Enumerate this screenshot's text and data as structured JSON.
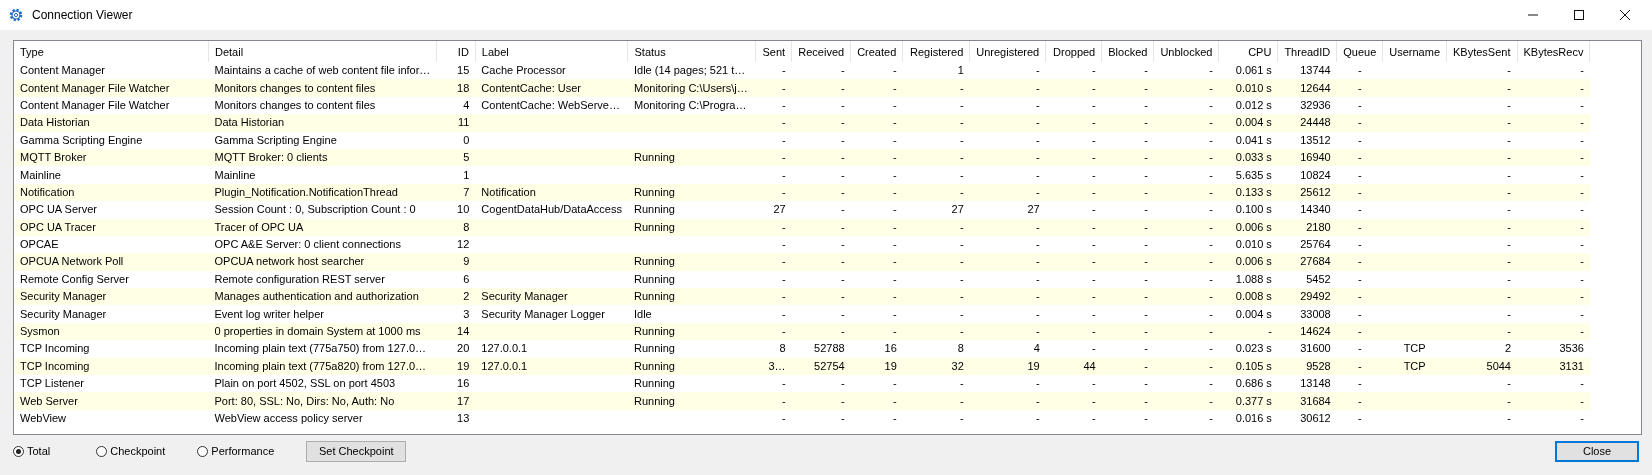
{
  "window": {
    "title": "Connection Viewer"
  },
  "table": {
    "columns": [
      {
        "label": "Type",
        "kind": "text"
      },
      {
        "label": "Detail",
        "kind": "text"
      },
      {
        "label": "ID",
        "kind": "number"
      },
      {
        "label": "Label",
        "kind": "text"
      },
      {
        "label": "Status",
        "kind": "text"
      },
      {
        "label": "Sent",
        "kind": "number"
      },
      {
        "label": "Received",
        "kind": "number"
      },
      {
        "label": "Created",
        "kind": "number"
      },
      {
        "label": "Registered",
        "kind": "number"
      },
      {
        "label": "Unregistered",
        "kind": "number"
      },
      {
        "label": "Dropped",
        "kind": "number"
      },
      {
        "label": "Blocked",
        "kind": "number"
      },
      {
        "label": "Unblocked",
        "kind": "number"
      },
      {
        "label": "CPU",
        "kind": "number"
      },
      {
        "label": "ThreadID",
        "kind": "number"
      },
      {
        "label": "Queue",
        "kind": "center"
      },
      {
        "label": "Username",
        "kind": "center"
      },
      {
        "label": "KBytesSent",
        "kind": "number"
      },
      {
        "label": "KBytesRecv",
        "kind": "number"
      }
    ],
    "rows": [
      [
        "Content Manager",
        "Maintains a cache of web content file infor…",
        "15",
        "Cache Processor",
        "Idle (14 pages; 521 t…",
        "-",
        "-",
        "-",
        "1",
        "-",
        "-",
        "-",
        "-",
        "0.061 s",
        "13744",
        "-",
        null,
        "-",
        "-"
      ],
      [
        "Content Manager File Watcher",
        "Monitors changes to content files",
        "18",
        "ContentCache: User",
        "Monitoring C:\\Users\\j…",
        "-",
        "-",
        "-",
        "-",
        "-",
        "-",
        "-",
        "-",
        "0.010 s",
        "12644",
        "-",
        null,
        "-",
        "-"
      ],
      [
        "Content Manager File Watcher",
        "Monitors changes to content files",
        "4",
        "ContentCache: WebServe…",
        "Monitoring C:\\Progra…",
        "-",
        "-",
        "-",
        "-",
        "-",
        "-",
        "-",
        "-",
        "0.012 s",
        "32936",
        "-",
        null,
        "-",
        "-"
      ],
      [
        "Data Historian",
        "Data Historian",
        "11",
        null,
        null,
        "-",
        "-",
        "-",
        "-",
        "-",
        "-",
        "-",
        "-",
        "0.004 s",
        "24448",
        "-",
        null,
        "-",
        "-"
      ],
      [
        "Gamma Scripting Engine",
        "Gamma Scripting Engine",
        "0",
        null,
        null,
        "-",
        "-",
        "-",
        "-",
        "-",
        "-",
        "-",
        "-",
        "0.041 s",
        "13512",
        "-",
        null,
        "-",
        "-"
      ],
      [
        "MQTT Broker",
        "MQTT Broker: 0 clients",
        "5",
        null,
        "Running",
        "-",
        "-",
        "-",
        "-",
        "-",
        "-",
        "-",
        "-",
        "0.033 s",
        "16940",
        "-",
        null,
        "-",
        "-"
      ],
      [
        "Mainline",
        "Mainline",
        "1",
        null,
        null,
        "-",
        "-",
        "-",
        "-",
        "-",
        "-",
        "-",
        "-",
        "5.635 s",
        "10824",
        "-",
        null,
        "-",
        "-"
      ],
      [
        "Notification",
        "Plugin_Notification.NotificationThread",
        "7",
        "Notification",
        "Running",
        "-",
        "-",
        "-",
        "-",
        "-",
        "-",
        "-",
        "-",
        "0.133 s",
        "25612",
        "-",
        null,
        "-",
        "-"
      ],
      [
        "OPC UA Server",
        "Session Count : 0, Subscription Count : 0",
        "10",
        "CogentDataHub/DataAccess",
        "Running",
        "27",
        "-",
        "-",
        "27",
        "27",
        "-",
        "-",
        "-",
        "0.100 s",
        "14340",
        "-",
        null,
        "-",
        "-"
      ],
      [
        "OPC UA Tracer",
        "Tracer of OPC UA",
        "8",
        null,
        "Running",
        "-",
        "-",
        "-",
        "-",
        "-",
        "-",
        "-",
        "-",
        "0.006 s",
        "2180",
        "-",
        null,
        "-",
        "-"
      ],
      [
        "OPCAE",
        "OPC A&E Server: 0 client connections",
        "12",
        null,
        null,
        "-",
        "-",
        "-",
        "-",
        "-",
        "-",
        "-",
        "-",
        "0.010 s",
        "25764",
        "-",
        null,
        "-",
        "-"
      ],
      [
        "OPCUA Network Poll",
        "OPCUA network host searcher",
        "9",
        null,
        "Running",
        "-",
        "-",
        "-",
        "-",
        "-",
        "-",
        "-",
        "-",
        "0.006 s",
        "27684",
        "-",
        null,
        "-",
        "-"
      ],
      [
        "Remote Config Server",
        "Remote configuration REST server",
        "6",
        null,
        "Running",
        "-",
        "-",
        "-",
        "-",
        "-",
        "-",
        "-",
        "-",
        "1.088 s",
        "5452",
        "-",
        null,
        "-",
        "-"
      ],
      [
        "Security Manager",
        "Manages authentication and authorization",
        "2",
        "Security Manager",
        "Running",
        "-",
        "-",
        "-",
        "-",
        "-",
        "-",
        "-",
        "-",
        "0.008 s",
        "29492",
        "-",
        null,
        "-",
        "-"
      ],
      [
        "Security Manager",
        "Event log writer helper",
        "3",
        "Security Manager Logger",
        "Idle",
        "-",
        "-",
        "-",
        "-",
        "-",
        "-",
        "-",
        "-",
        "0.004 s",
        "33008",
        "-",
        null,
        "-",
        "-"
      ],
      [
        "Sysmon",
        "0 properties in domain System at 1000 ms",
        "14",
        null,
        "Running",
        "-",
        "-",
        "-",
        "-",
        "-",
        "-",
        "-",
        "-",
        "-",
        "14624",
        "-",
        null,
        "-",
        "-"
      ],
      [
        "TCP Incoming",
        "Incoming plain text (775a750) from 127.0…",
        "20",
        "127.0.0.1",
        "Running",
        "8",
        "52788",
        "16",
        "8",
        "4",
        "-",
        "-",
        "-",
        "0.023 s",
        "31600",
        "-",
        "TCP",
        "2",
        "3536"
      ],
      [
        "TCP Incoming",
        "Incoming plain text (775a820) from 127.0…",
        "19",
        "127.0.0.1",
        "Running",
        "3…",
        "52754",
        "19",
        "32",
        "19",
        "44",
        "-",
        "-",
        "0.105 s",
        "9528",
        "-",
        "TCP",
        "5044",
        "3131"
      ],
      [
        "TCP Listener",
        "Plain on port 4502, SSL on port 4503",
        "16",
        null,
        "Running",
        "-",
        "-",
        "-",
        "-",
        "-",
        "-",
        "-",
        "-",
        "0.686 s",
        "13148",
        "-",
        null,
        "-",
        "-"
      ],
      [
        "Web Server",
        "Port: 80, SSL: No, Dirs: No, Auth: No",
        "17",
        null,
        "Running",
        "-",
        "-",
        "-",
        "-",
        "-",
        "-",
        "-",
        "-",
        "0.377 s",
        "31684",
        "-",
        null,
        "-",
        "-"
      ],
      [
        "WebView",
        "WebView access policy server",
        "13",
        null,
        null,
        "-",
        "-",
        "-",
        "-",
        "-",
        "-",
        "-",
        "-",
        "0.016 s",
        "30612",
        "-",
        null,
        "-",
        "-"
      ]
    ]
  },
  "modes": [
    {
      "label": "Total",
      "selected": true
    },
    {
      "label": "Checkpoint",
      "selected": false
    },
    {
      "label": "Performance",
      "selected": false
    }
  ],
  "buttons": {
    "set_checkpoint": "Set Checkpoint",
    "close": "Close"
  }
}
